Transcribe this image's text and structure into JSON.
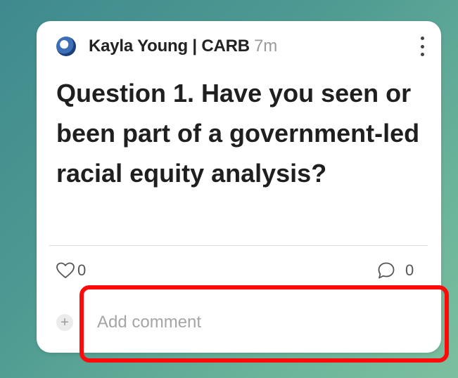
{
  "post": {
    "author": "Kayla Young | CARB",
    "time": "7m",
    "question": "Question 1. Have you seen or been part of a government-led racial equity analysis?",
    "likes": "0",
    "comments": "0"
  },
  "comment_box": {
    "placeholder": "Add comment",
    "add_icon": "+"
  },
  "icons": {
    "avatar": "globe-logo",
    "menu": "kebab-menu-icon",
    "like": "heart-outline-icon",
    "comment": "speech-bubble-icon",
    "add": "plus-circle-icon"
  },
  "colors": {
    "highlight": "#ff0a0a",
    "background_start": "#3f8a8e",
    "background_end": "#7cbf9f"
  }
}
